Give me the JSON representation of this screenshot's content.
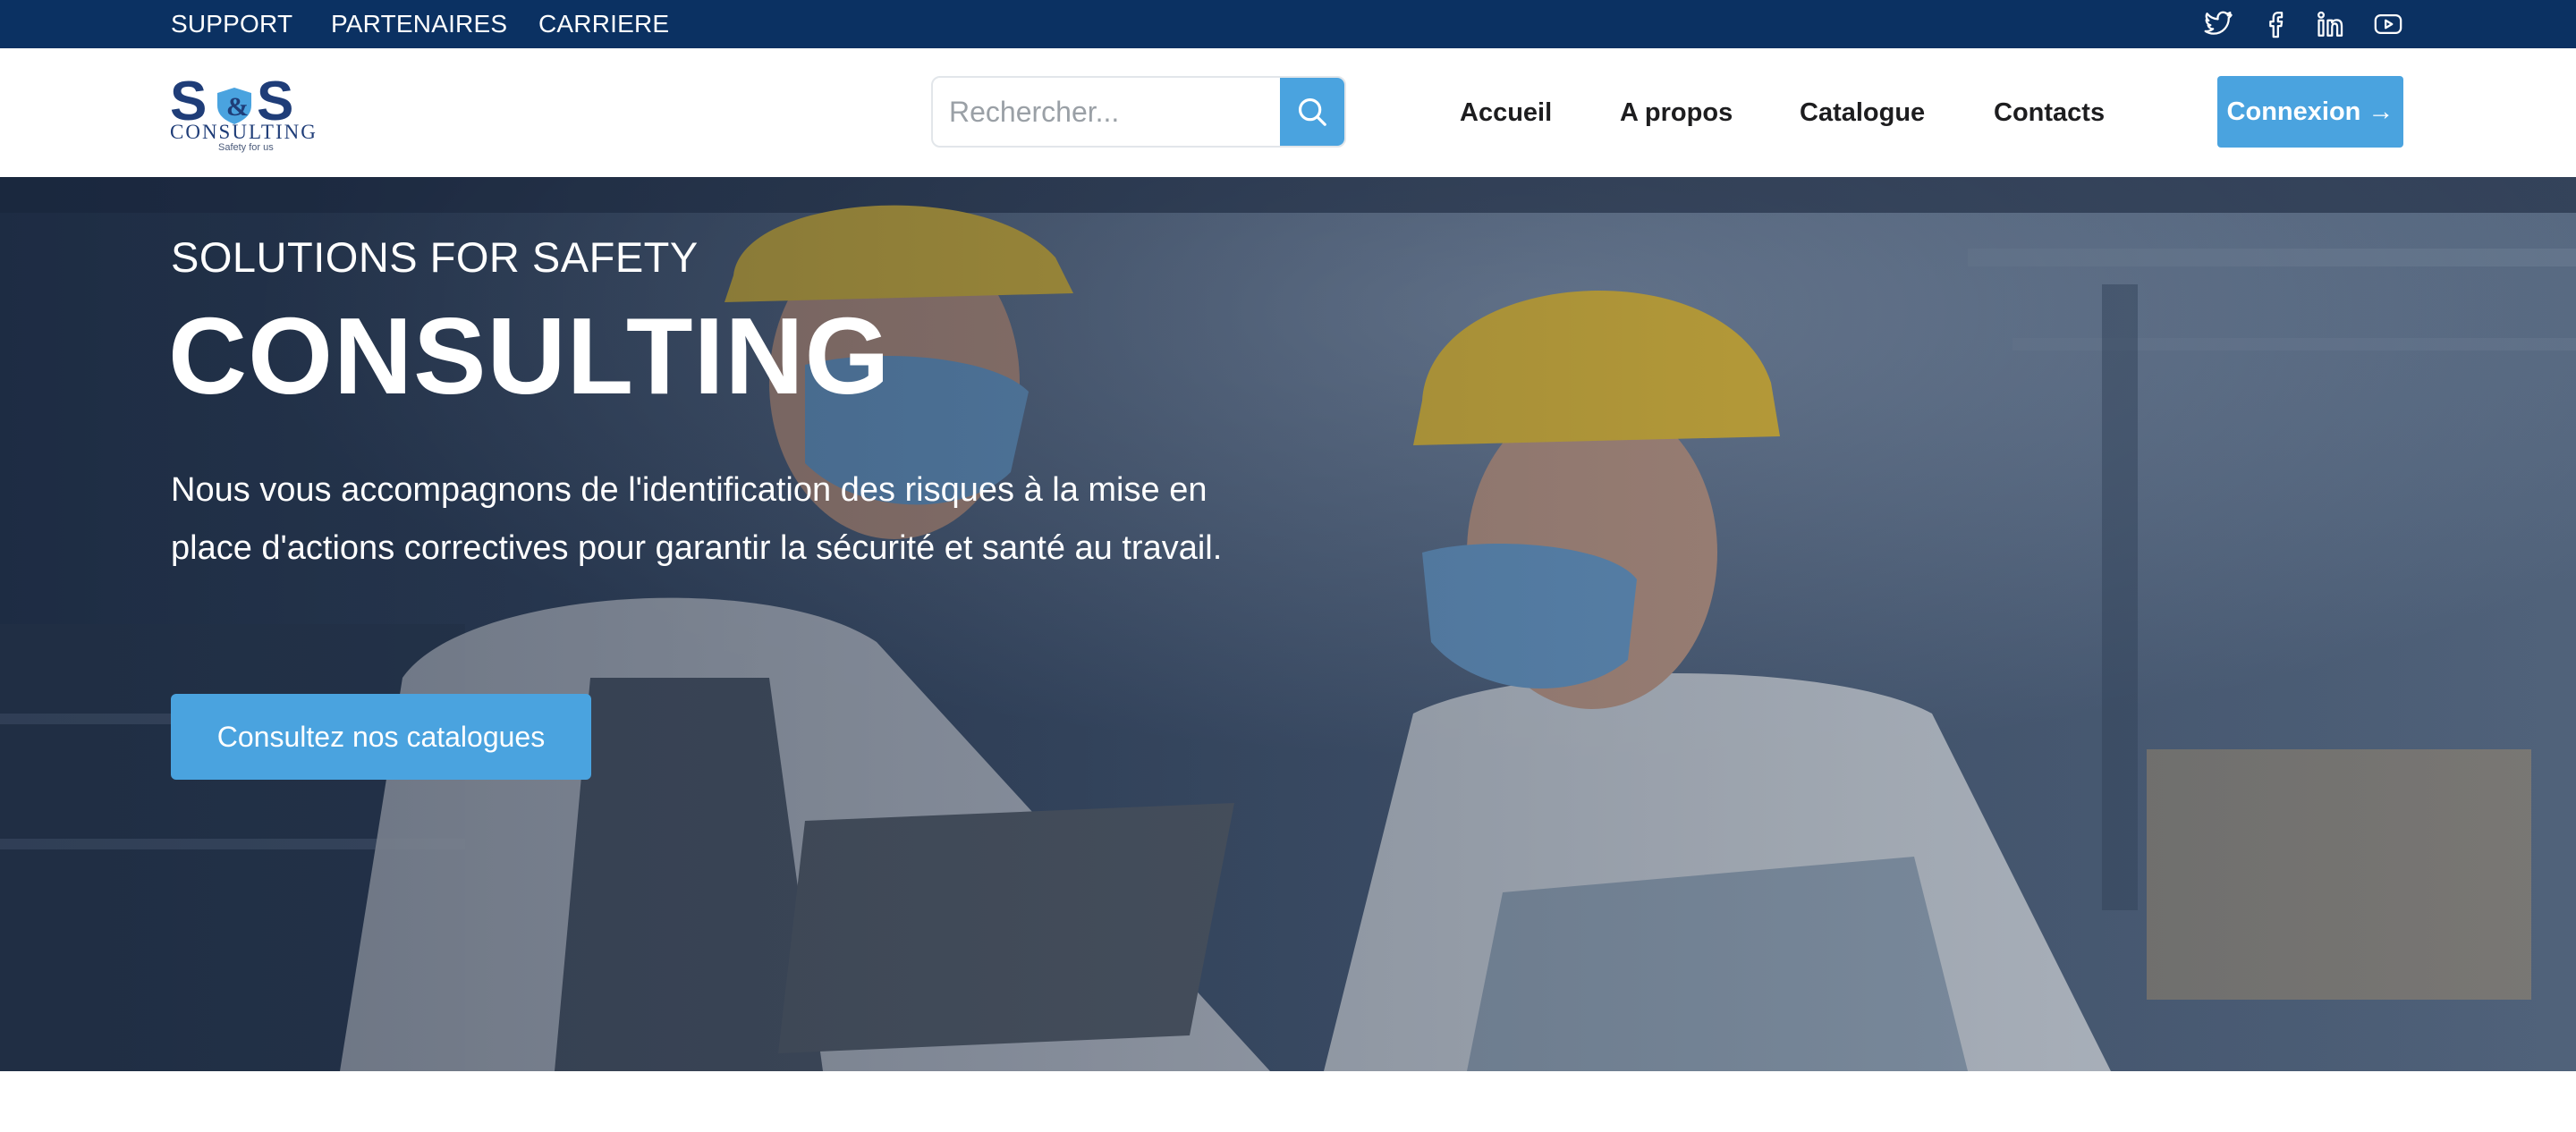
{
  "topbar": {
    "links": [
      "SUPPORT",
      "PARTENAIRES",
      "CARRIERE"
    ],
    "social_icons": [
      "twitter-icon",
      "facebook-icon",
      "linkedin-icon",
      "youtube-icon"
    ]
  },
  "header": {
    "logo": {
      "mark": "S&S",
      "name": "CONSULTING",
      "tagline": "Safety for us"
    },
    "search": {
      "placeholder": "Rechercher...",
      "value": ""
    },
    "nav": [
      "Accueil",
      "A propos",
      "Catalogue",
      "Contacts"
    ],
    "login_label": "Connexion →"
  },
  "hero": {
    "kicker": "SOLUTIONS FOR SAFETY",
    "title": "CONSULTING",
    "description": "Nous vous accompagnons de l'identification des risques à la mise en place d'actions correctives pour garantir la sécurité et santé au travail.",
    "cta_label": "Consultez nos catalogues"
  },
  "colors": {
    "topbar": "#0b3162",
    "accent": "#4aa3df",
    "logo_navy": "#1f3d78",
    "nav_text": "#1d1d1f"
  }
}
